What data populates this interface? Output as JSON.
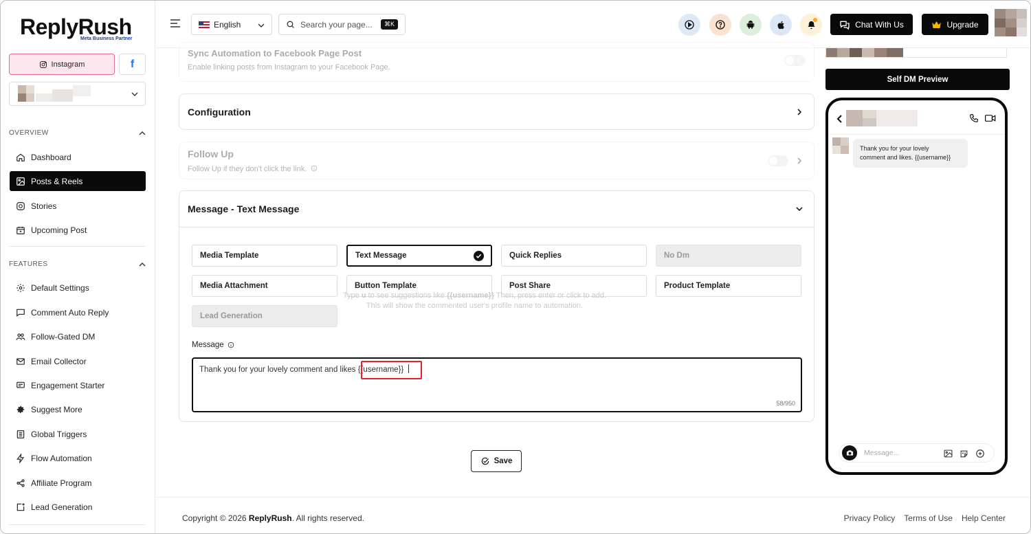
{
  "brand": {
    "name": "ReplyRush",
    "partner": "Meta Business Partner"
  },
  "sidebar": {
    "platforms": {
      "instagram": "Instagram",
      "facebook": "f"
    },
    "overview_label": "OVERVIEW",
    "features_label": "FEATURES",
    "overview": [
      {
        "label": "Dashboard",
        "icon": "home-icon"
      },
      {
        "label": "Posts & Reels",
        "icon": "image-icon",
        "active": true
      },
      {
        "label": "Stories",
        "icon": "instagram-icon"
      },
      {
        "label": "Upcoming Post",
        "icon": "calendar-icon"
      }
    ],
    "features": [
      {
        "label": "Default Settings",
        "icon": "gear-icon"
      },
      {
        "label": "Comment Auto Reply",
        "icon": "comment-icon"
      },
      {
        "label": "Follow-Gated DM",
        "icon": "users-icon"
      },
      {
        "label": "Email Collector",
        "icon": "mail-icon"
      },
      {
        "label": "Engagement Starter",
        "icon": "chat-icon"
      },
      {
        "label": "Suggest More",
        "icon": "cog-icon"
      },
      {
        "label": "Global Triggers",
        "icon": "list-icon"
      },
      {
        "label": "Flow Automation",
        "icon": "bolt-icon"
      },
      {
        "label": "Affiliate Program",
        "icon": "share-icon"
      },
      {
        "label": "Lead Generation",
        "icon": "plus-square-icon"
      }
    ]
  },
  "header": {
    "language": "English",
    "search_placeholder": "Search your page...",
    "search_shortcut": "⌘K",
    "chat_button": "Chat With Us",
    "upgrade_button": "Upgrade"
  },
  "main": {
    "sync": {
      "title": "Sync Automation to Facebook Page Post",
      "description": "Enable linking posts from Instagram to your Facebook Page."
    },
    "configuration": {
      "title": "Configuration"
    },
    "follow_up": {
      "title": "Follow Up",
      "description": "Follow Up if they don't click the link."
    },
    "message_section": {
      "title": "Message - Text Message",
      "options": [
        {
          "label": "Media Template",
          "state": "normal"
        },
        {
          "label": "Text Message",
          "state": "selected"
        },
        {
          "label": "Quick Replies",
          "state": "normal"
        },
        {
          "label": "No Dm",
          "state": "disabled"
        },
        {
          "label": "Media Attachment",
          "state": "normal"
        },
        {
          "label": "Button Template",
          "state": "normal"
        },
        {
          "label": "Post Share",
          "state": "normal"
        },
        {
          "label": "Product Template",
          "state": "normal"
        },
        {
          "label": "Lead Generation",
          "state": "disabled"
        }
      ],
      "hint_line1_pre": "Type",
      "hint_key": "u",
      "hint_line1_mid": "to see suggestions like",
      "hint_token": "{{username}}",
      "hint_line1_post": "Then, press enter or click to add.",
      "hint_line2": "This will show the commented user's profile name to automation.",
      "message_label": "Message",
      "message_text": "Thank you for your lovely comment and likes",
      "message_token": "{{username}}",
      "char_count": "58/950"
    },
    "save_button": "Save"
  },
  "preview": {
    "button": "Self DM Preview",
    "bubble_line1": "Thank you for your lovely",
    "bubble_line2": "comment and likes. {{username}}",
    "input_placeholder": "Message..."
  },
  "footer": {
    "copyright_pre": "Copyright © 2026",
    "copyright_brand": "ReplyRush",
    "copyright_post": ". All rights reserved.",
    "links": [
      "Privacy Policy",
      "Terms of Use",
      "Help Center"
    ]
  }
}
